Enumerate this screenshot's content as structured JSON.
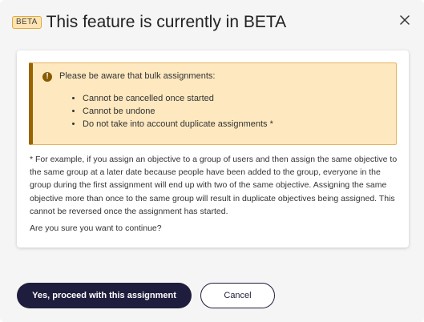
{
  "header": {
    "badge": "BETA",
    "title": "This feature is currently in BETA",
    "close_icon": "close-icon"
  },
  "warning": {
    "icon": "exclamation-circle-icon",
    "intro": "Please be aware that bulk assignments:",
    "items": [
      "Cannot be cancelled once started",
      "Cannot be undone",
      "Do not take into account duplicate assignments *"
    ]
  },
  "note": "* For example, if you assign an objective to a group of users and then assign the same objective to the same group at a later date because people have been added to the group, everyone in the group during the first assignment will end up with two of the same objective. Assigning the same objective more than once to the same group will result in duplicate objectives being assigned. This cannot be reversed once the assignment has started.",
  "question": "Are you sure you want to continue?",
  "actions": {
    "confirm_label": "Yes, proceed with this assignment",
    "cancel_label": "Cancel"
  },
  "colors": {
    "primary": "#1f1d3d",
    "warning_bg": "#fde8bf",
    "warning_accent": "#9a6400",
    "badge_bg": "#fde4b2"
  }
}
